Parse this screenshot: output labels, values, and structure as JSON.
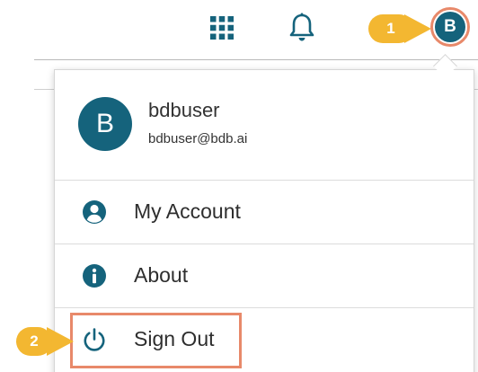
{
  "topbar": {
    "apps_icon": "apps-grid-icon",
    "bell_icon": "bell-icon",
    "avatar_initial": "B"
  },
  "callouts": {
    "step1": "1",
    "step2": "2"
  },
  "profile_menu": {
    "avatar_initial": "B",
    "username": "bdbuser",
    "email": "bdbuser@bdb.ai",
    "items": [
      {
        "label": "My Account",
        "icon": "user-circle-icon"
      },
      {
        "label": "About",
        "icon": "info-icon"
      },
      {
        "label": "Sign Out",
        "icon": "power-icon"
      }
    ]
  },
  "colors": {
    "brand": "#15637c",
    "callout": "#f3b731",
    "highlight": "#e8896a"
  }
}
